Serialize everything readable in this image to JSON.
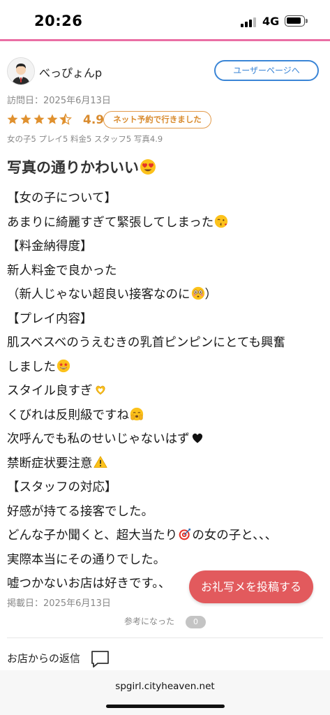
{
  "status_bar": {
    "time": "20:26",
    "network": "4G"
  },
  "review": {
    "username": "べっぴょんp",
    "user_page_button": "ユーザーページへ",
    "visit_date": "訪問日：2025年6月13日",
    "rating": "4.9",
    "star_rating": 4.5,
    "booking_badge": "ネット予約で行きました",
    "sub_ratings": "女の子5 プレイ5 料金5 スタッフ5 写真4.9",
    "title": "写真の通りかわいい",
    "title_emoji": "heart-eyes-emoji",
    "body_lines": [
      "【女の子について】",
      "あまりに綺麗すぎて緊張してしまった",
      "【料金納得度】",
      "新人料金で良かった",
      "（新人じゃない超良い接客なのに",
      "）",
      "【プレイ内容】",
      "肌スベスベのうえむきの乳首ピンピンにとても興奮",
      "しました",
      "スタイル良すぎ",
      "くびれは反則級ですね",
      "次呼んでも私のせいじゃないはず",
      "禁断症状要注意",
      "【スタッフの対応】",
      "好感が持てる接客でした。",
      "どんな子か聞くと、超大当たり",
      "の女の子と、、、",
      "実際本当にその通りでした。",
      "嘘つかないお店は好きです。、"
    ],
    "body_emojis": [
      "kiss-emoji",
      "flushed-emoji",
      "star-struck-emoji",
      "heart-hands-emoji",
      "shy-emoji",
      "black-heart-emoji",
      "warning-emoji",
      "dart-emoji"
    ],
    "post_date": "掲載日：2025年6月13日",
    "helpful_label": "参考になった",
    "helpful_count": "0"
  },
  "fab_label": "お礼写メを投稿する",
  "shop_reply_label": "お店からの返信",
  "browser": {
    "url": "spgirl.cityheaven.net"
  },
  "colors": {
    "accent_pink": "#ea6fa4",
    "star": "#e0912f",
    "link_blue": "#3a85d6",
    "fab_red": "#e25a5d"
  }
}
